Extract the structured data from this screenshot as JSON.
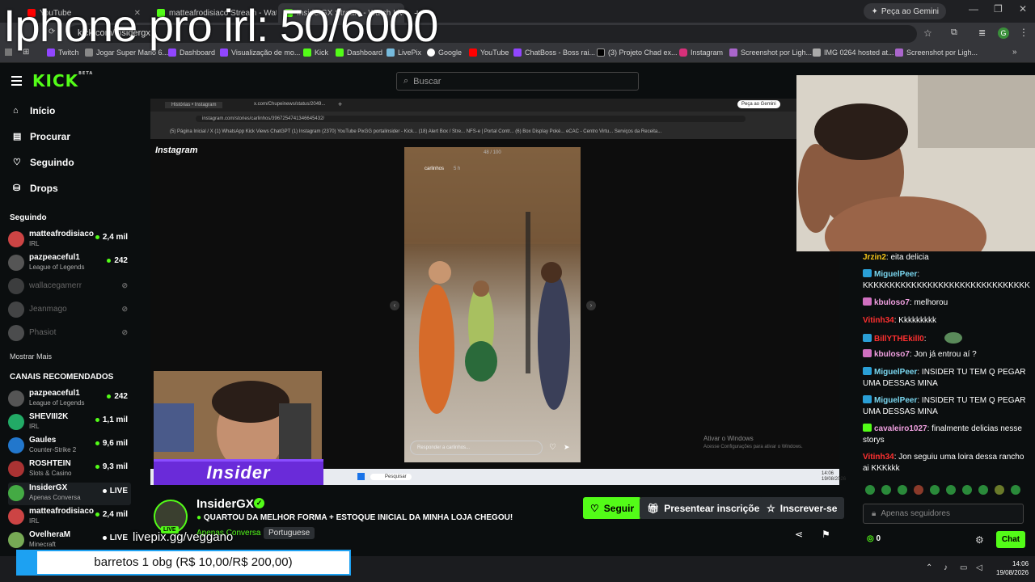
{
  "overlay_title": "Iphone pro irl: 50/6000",
  "browser": {
    "tabs": [
      {
        "label": "YouTube",
        "color": "#ff0000"
      },
      {
        "label": "matteafrodisiaco Stream - Watch",
        "color": "#53fc18"
      },
      {
        "label": "InsiderGX Stream - Watch Live",
        "color": "#53fc18"
      }
    ],
    "gemini": "Peça ao Gemini",
    "url": "kick.com/insidergx",
    "bookmarks": [
      "Twitch",
      "Jogar Super Mario 6...",
      "Dashboard",
      "Visualização de mo...",
      "Kick",
      "Dashboard",
      "LivePix",
      "Google",
      "YouTube",
      "ChatBoss - Boss rai...",
      "(3) Projeto Chad ex...",
      "Instagram",
      "Screenshot por Ligh...",
      "IMG 0264 hosted at...",
      "Screenshot por Ligh..."
    ]
  },
  "kick": {
    "logo": "KICK",
    "logo_sup": "BETA",
    "search_placeholder": "Buscar",
    "nav": [
      "Início",
      "Procurar",
      "Seguindo",
      "Drops"
    ],
    "following_title": "Seguindo",
    "following": [
      {
        "name": "matteafrodisiaco",
        "cat": "IRL",
        "viewers": "2,4 mil",
        "online": true,
        "color": "#c44"
      },
      {
        "name": "pazpeaceful1",
        "cat": "League of Legends",
        "viewers": "242",
        "online": true,
        "color": "#555"
      },
      {
        "name": "wallacegamerr",
        "cat": "",
        "viewers": "",
        "online": false,
        "color": "#777"
      },
      {
        "name": "Jeanmago",
        "cat": "",
        "viewers": "",
        "online": false,
        "color": "#888"
      },
      {
        "name": "Phasiot",
        "cat": "",
        "viewers": "",
        "online": false,
        "color": "#999"
      }
    ],
    "show_more": "Mostrar Mais",
    "recommended_title": "CANAIS RECOMENDADOS",
    "recommended": [
      {
        "name": "pazpeaceful1",
        "cat": "League of Legends",
        "viewers": "242",
        "color": "#555"
      },
      {
        "name": "SHEVIII2K",
        "cat": "IRL",
        "viewers": "1,1 mil",
        "color": "#2a6"
      },
      {
        "name": "Gaules",
        "cat": "Counter-Strike 2",
        "viewers": "9,6 mil",
        "color": "#27c"
      },
      {
        "name": "ROSHTEIN",
        "cat": "Slots & Casino",
        "viewers": "9,3 mil",
        "color": "#a33"
      },
      {
        "name": "InsiderGX",
        "cat": "Apenas Conversa",
        "viewers": "LIVE",
        "color": "#4a4"
      },
      {
        "name": "matteafrodisiaco",
        "cat": "IRL",
        "viewers": "2,4 mil",
        "color": "#c44"
      },
      {
        "name": "OvelheraM",
        "cat": "Minecraft",
        "viewers": "LIVE",
        "color": "#7a5"
      }
    ]
  },
  "inner_screen": {
    "tabs": [
      "Histórias • Instagram",
      "x.com/Chupeinews/status/2049...",
      "+"
    ],
    "gemini": "Peça ao Gemini",
    "url": "instagram.com/stories/carlinhos/3967254741346645432/",
    "bookmarks": "(5) Página Inicial / X   (1) WhatsApp   Kick   Views   ChatGPT   (1) Instagram   (2370) YouTube   PixGG   portalinsider - Kick...   (18) Alert Box / Stre...   NFS-e | Portal Contr...   (6) Box Display Pokè...   eCAC - Centro Virtu...   Serviços da Receita...",
    "instagram": "Instagram",
    "story_counter": "48 / 100",
    "story_user": "carlinhos",
    "story_time": "5 h",
    "story_reply": "Responder a carlinhos...",
    "win_watermark": "Ativar o Windows",
    "win_watermark2": "Acesse Configurações para ativar o Windows.",
    "taskbar_search": "Pesquisar",
    "clock": "14:06\n19/08/2026"
  },
  "banner": "Insider",
  "stream": {
    "name": "InsiderGX",
    "live": "LIVE",
    "title": "QUARTOU DA MELHOR FORMA + ESTOQUE INICIAL DA MINHA LOJA CHEGOU!",
    "category": "Apenas Conversa",
    "language": "Portuguese",
    "follow": "Seguir",
    "gift": "Presentear inscrições",
    "subscribe": "Inscrever-se"
  },
  "chat": {
    "messages": [
      {
        "user": "Jrzin2",
        "color": "#f5c518",
        "text": "eita delicia",
        "badge": ""
      },
      {
        "user": "MiguelPeer",
        "color": "#7ad7f0",
        "text": "KKKKKKKKKKKKKKKKKKKKKKKKKKKKKKK",
        "badge": "#2a9fd6"
      },
      {
        "user": "kbuloso7",
        "color": "#f0a0e0",
        "text": "melhorou",
        "badge": "#d070c0"
      },
      {
        "user": "Vitinh34",
        "color": "#ff3030",
        "text": "Kkkkkkkkk",
        "badge": ""
      },
      {
        "user": "BillYTHEkill0",
        "color": "#ff3030",
        "text": "",
        "badge": "#2a9fd6"
      },
      {
        "user": "kbuloso7",
        "color": "#f0a0e0",
        "text": "Jon já entrou aí ?",
        "badge": "#d070c0"
      },
      {
        "user": "MiguelPeer",
        "color": "#7ad7f0",
        "text": "INSIDER TU TEM Q PEGAR UMA DESSAS MINA",
        "badge": "#2a9fd6"
      },
      {
        "user": "MiguelPeer",
        "color": "#7ad7f0",
        "text": "INSIDER TU TEM Q PEGAR UMA DESSAS MINA",
        "badge": "#2a9fd6"
      },
      {
        "user": "cavaleiro1027",
        "color": "#f0a0e0",
        "text": "finalmente delicias nesse storys",
        "badge": "#53fc18"
      },
      {
        "user": "Vitinh34",
        "color": "#ff3030",
        "text": "Jon seguiu uma loira dessa rancho ai KKKkkk",
        "badge": ""
      }
    ],
    "input_placeholder": "Apenas seguidores",
    "points": "0",
    "send": "Chat"
  },
  "livepix": "livepix.gg/veggano",
  "donation": "barretos 1 obg (R$ 10,00/R$ 200,00)",
  "os_clock": {
    "time": "14:06",
    "date": "19/08/2026"
  }
}
